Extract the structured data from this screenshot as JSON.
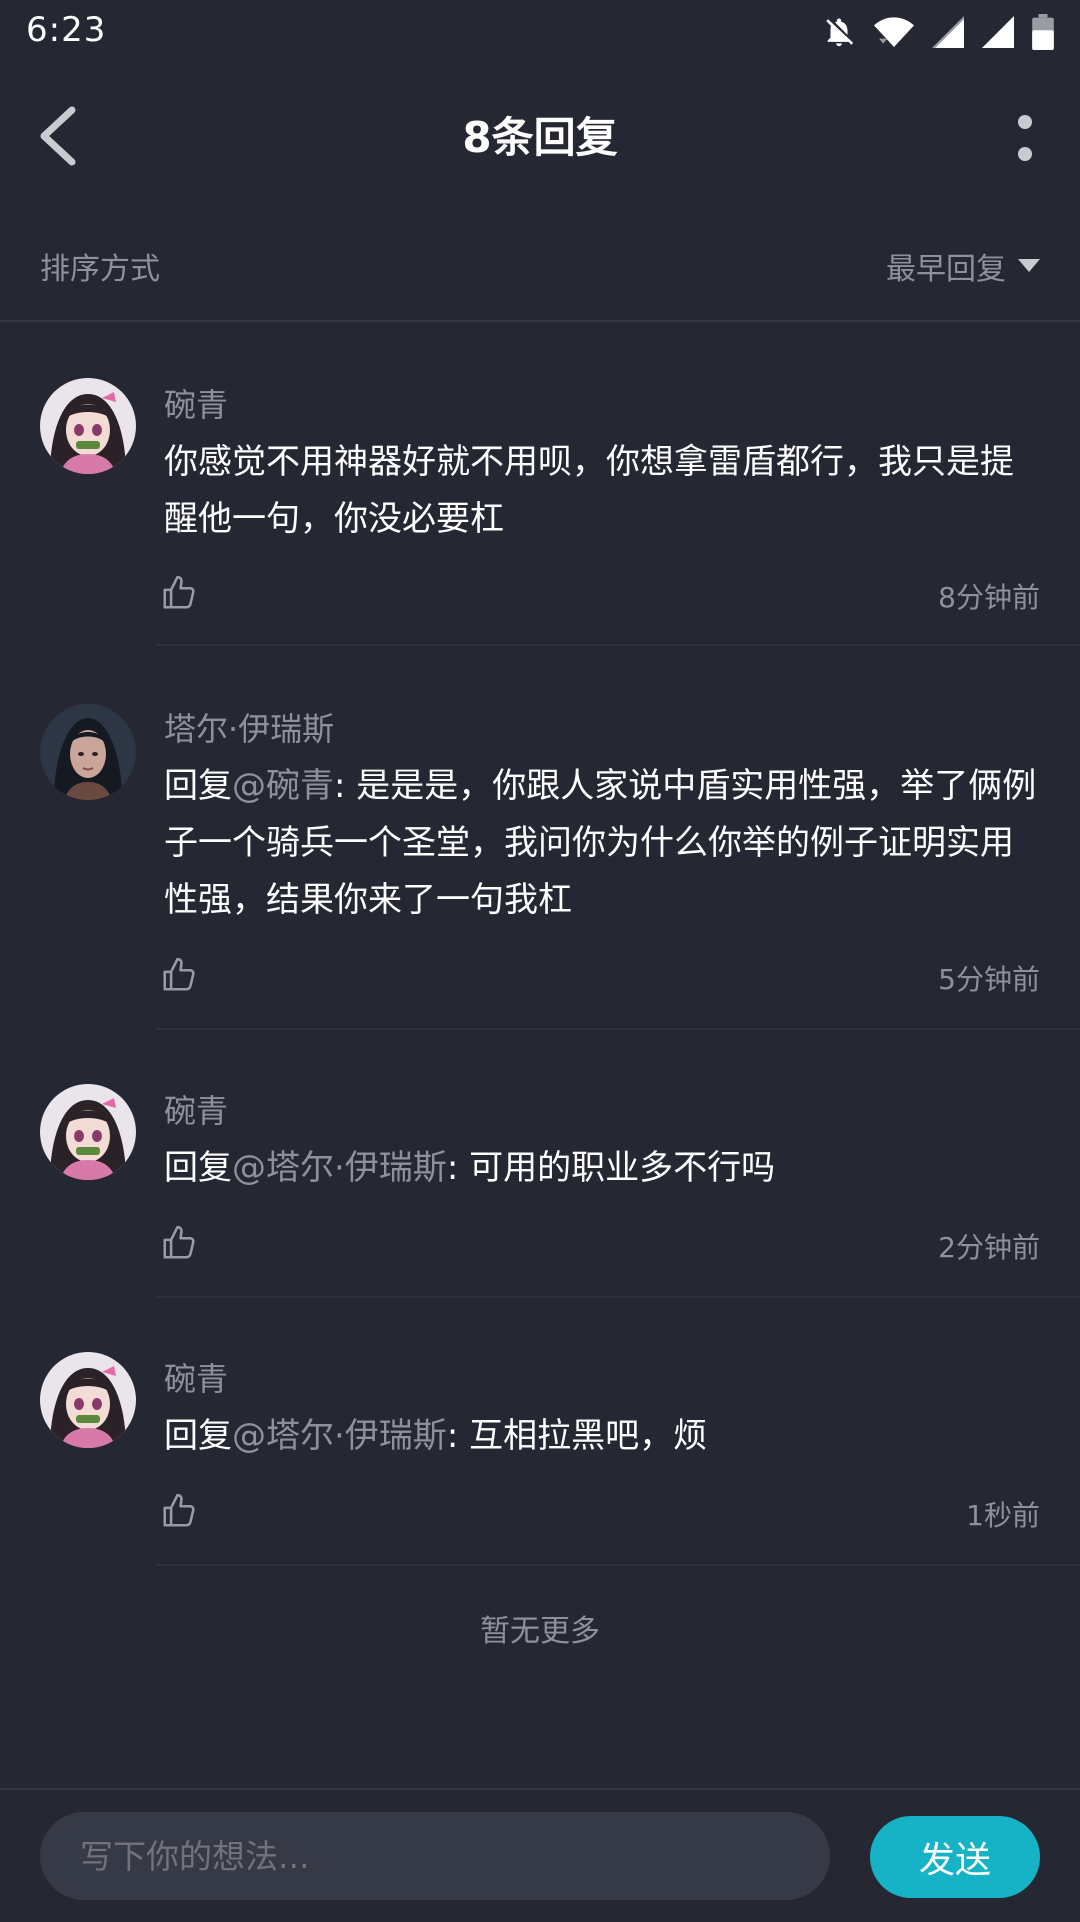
{
  "status_bar": {
    "time": "6:23"
  },
  "header": {
    "title": "8条回复"
  },
  "sort": {
    "label": "排序方式",
    "selected": "最早回复"
  },
  "replies": [
    {
      "username": "碗青",
      "prefix": "",
      "mention": "",
      "sep": "",
      "text": "你感觉不用神器好就不用呗，你想拿雷盾都行，我只是提醒他一句，你没必要杠",
      "time": "8分钟前",
      "avatar": "demon-girl-avatar"
    },
    {
      "username": "塔尔·伊瑞斯",
      "prefix": "回复",
      "mention": "@碗青",
      "sep": ": ",
      "text": "是是是，你跟人家说中盾实用性强，举了俩例子一个骑兵一个圣堂，我问你为什么你举的例子证明实用性强，结果你来了一句我杠",
      "time": "5分钟前",
      "avatar": "dark-hair-character-avatar"
    },
    {
      "username": "碗青",
      "prefix": "回复",
      "mention": "@塔尔·伊瑞斯",
      "sep": ": ",
      "text": "可用的职业多不行吗",
      "time": "2分钟前",
      "avatar": "demon-girl-avatar"
    },
    {
      "username": "碗青",
      "prefix": "回复",
      "mention": "@塔尔·伊瑞斯",
      "sep": ": ",
      "text": "互相拉黑吧，烦",
      "time": "1秒前",
      "avatar": "demon-girl-avatar"
    }
  ],
  "footer_text": "暂无更多",
  "composer": {
    "placeholder": "写下你的想法...",
    "send_label": "发送"
  },
  "colors": {
    "background": "#252833",
    "accent": "#16b3c7",
    "muted": "#8e919a"
  }
}
